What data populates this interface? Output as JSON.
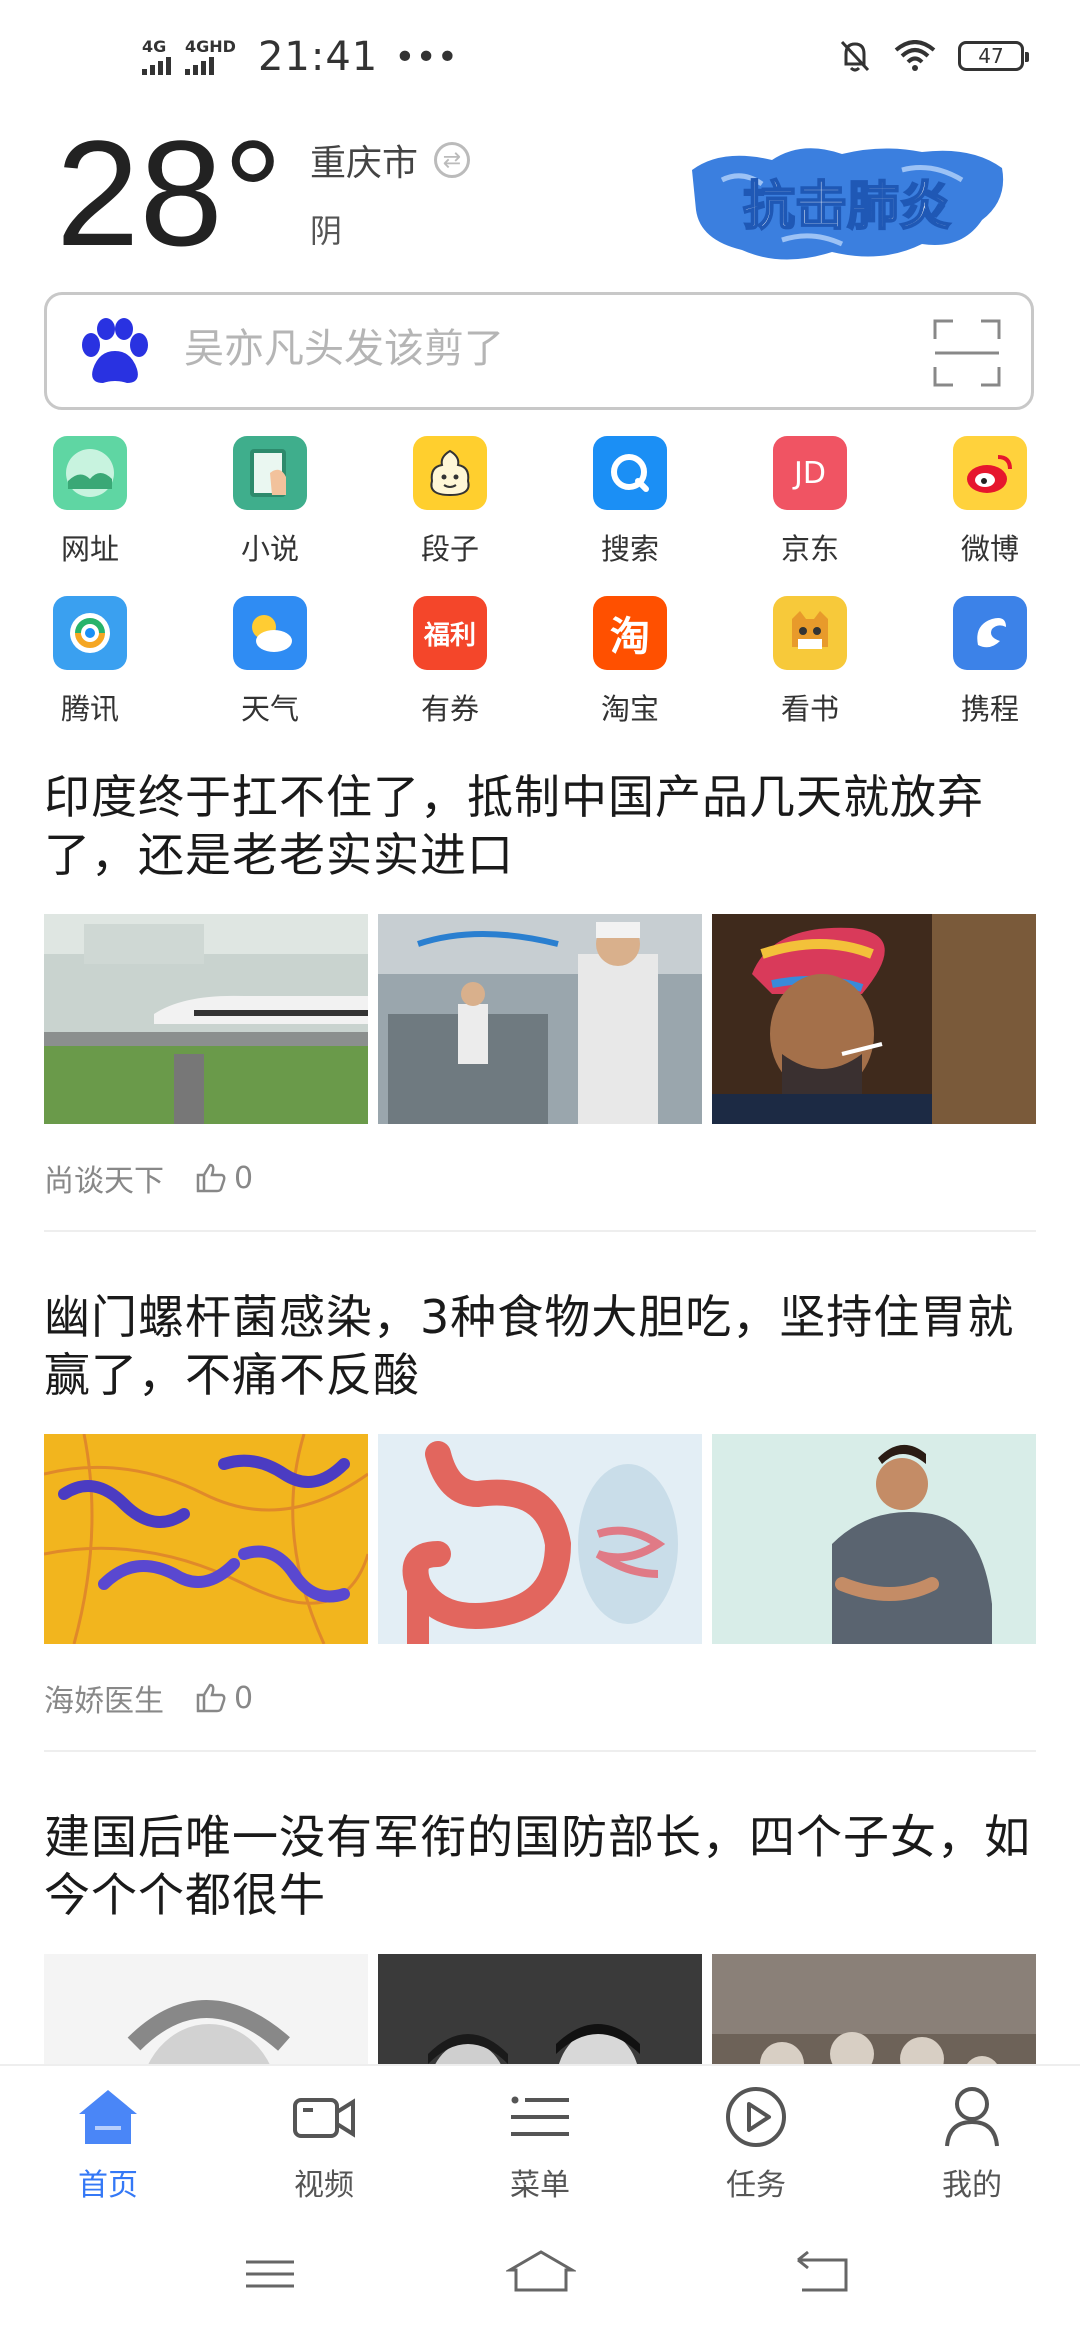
{
  "status_bar": {
    "signal1": "4G",
    "signal2": "4GHD",
    "time": "21:41",
    "more": "•••",
    "battery": "47"
  },
  "weather": {
    "temperature": "28°",
    "city": "重庆市",
    "condition": "阴",
    "banner_text": "抗击肺炎"
  },
  "search": {
    "placeholder": "吴亦凡头发该剪了"
  },
  "apps": [
    {
      "label": "网址",
      "icon": "globe-icon"
    },
    {
      "label": "小说",
      "icon": "book-icon"
    },
    {
      "label": "段子",
      "icon": "joke-icon"
    },
    {
      "label": "搜索",
      "icon": "search-icon"
    },
    {
      "label": "京东",
      "icon": "jd-icon",
      "glyph": "JD"
    },
    {
      "label": "微博",
      "icon": "weibo-icon"
    },
    {
      "label": "腾讯",
      "icon": "tencent-icon"
    },
    {
      "label": "天气",
      "icon": "weather-icon"
    },
    {
      "label": "有券",
      "icon": "coupon-icon",
      "glyph": "福利"
    },
    {
      "label": "淘宝",
      "icon": "taobao-icon",
      "glyph": "淘"
    },
    {
      "label": "看书",
      "icon": "cat-book-icon"
    },
    {
      "label": "携程",
      "icon": "ctrip-icon"
    }
  ],
  "articles": [
    {
      "title": "印度终于扛不住了，抵制中国产品几天就放弃了，还是老老实实进口",
      "source": "尚谈天下",
      "likes": "0"
    },
    {
      "title": "幽门螺杆菌感染，3种食物大胆吃，坚持住胃就赢了，不痛不反酸",
      "source": "海娇医生",
      "likes": "0"
    },
    {
      "title": "建国后唯一没有军衔的国防部长，四个子女，如今个个都很牛",
      "source": "",
      "likes": ""
    }
  ],
  "bottom_nav": [
    {
      "label": "首页",
      "icon": "home-icon",
      "active": true
    },
    {
      "label": "视频",
      "icon": "video-icon",
      "active": false
    },
    {
      "label": "菜单",
      "icon": "menu-icon",
      "active": false
    },
    {
      "label": "任务",
      "icon": "play-circle-icon",
      "active": false
    },
    {
      "label": "我的",
      "icon": "user-icon",
      "active": false
    }
  ],
  "colors": {
    "accent": "#3478f6",
    "text": "#1a1a1a",
    "muted": "#888888"
  }
}
